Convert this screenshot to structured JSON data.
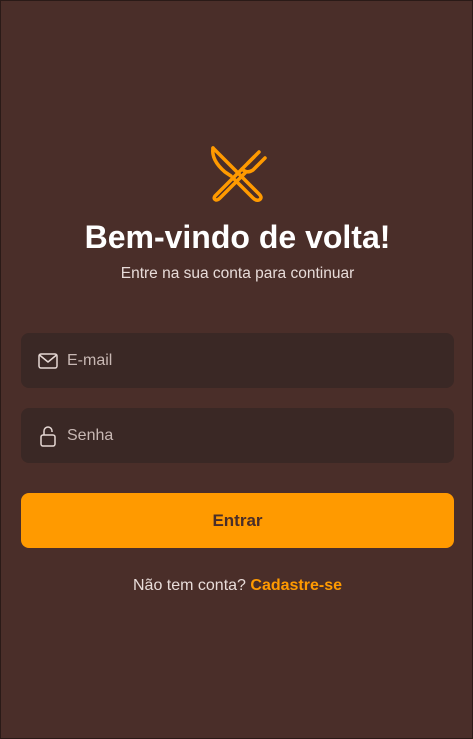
{
  "header": {
    "logo_icon": "fork-knife-icon",
    "title": "Bem-vindo de volta!",
    "subtitle": "Entre na sua conta para continuar"
  },
  "form": {
    "email": {
      "icon": "envelope-icon",
      "placeholder": "E-mail",
      "value": ""
    },
    "password": {
      "icon": "lock-icon",
      "placeholder": "Senha",
      "value": ""
    },
    "submit_label": "Entrar"
  },
  "footer": {
    "prompt": "Não tem conta?",
    "signup_link": "Cadastre-se"
  },
  "colors": {
    "background": "#4a2e29",
    "field_background": "#3a2825",
    "accent": "#ff9a00",
    "text": "#ffffff"
  }
}
